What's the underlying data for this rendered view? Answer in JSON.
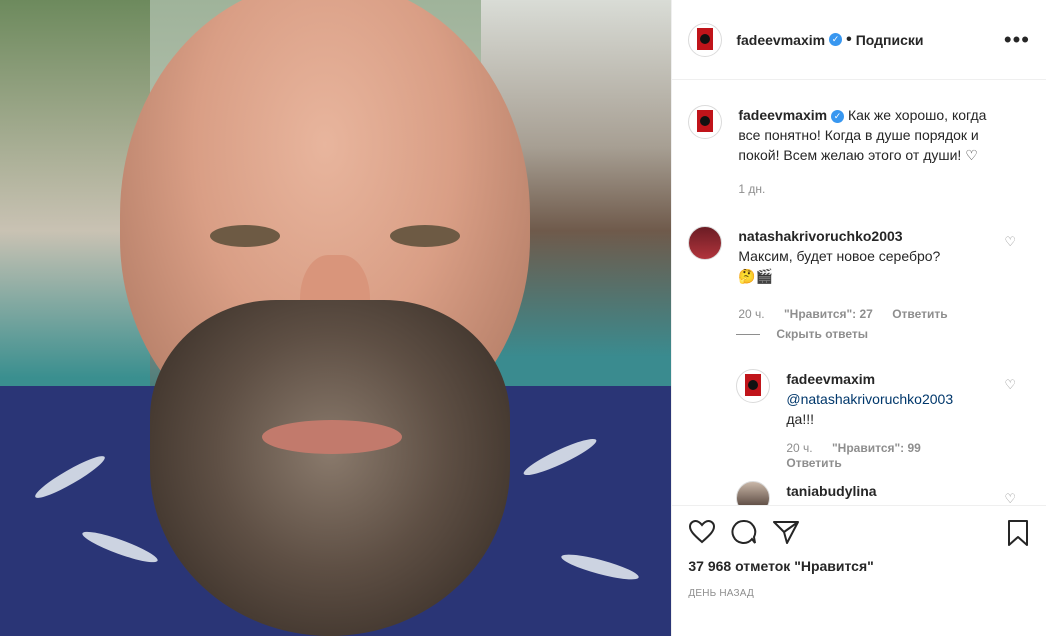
{
  "post": {
    "author": "fadeevmaxim",
    "follow_label": "Подписки",
    "dot": "•",
    "more_label": "•••"
  },
  "caption": {
    "author": "fadeevmaxim",
    "text": "Как же хорошо, когда все понятно! Когда в душе порядок и покой! Всем желаю этого от души! ♡",
    "time": "1 дн."
  },
  "comments": [
    {
      "author": "natashakrivoruchko2003",
      "text": "Максим, будет новое серебро?",
      "emoji": "🤔🎬",
      "time": "20 ч.",
      "likes": "\"Нравится\": 27",
      "reply_label": "Ответить",
      "hide_replies": "Скрыть ответы"
    },
    {
      "author": "fadeevmaxim",
      "mention": "@natashakrivoruchko2003",
      "text": "да!!!",
      "time": "20 ч.",
      "likes": "\"Нравится\": 99",
      "reply_label": "Ответить"
    },
    {
      "author": "taniabudylina"
    }
  ],
  "actions": {
    "likes_count": "37 968 отметок \"Нравится\"",
    "posted": "День назад"
  }
}
